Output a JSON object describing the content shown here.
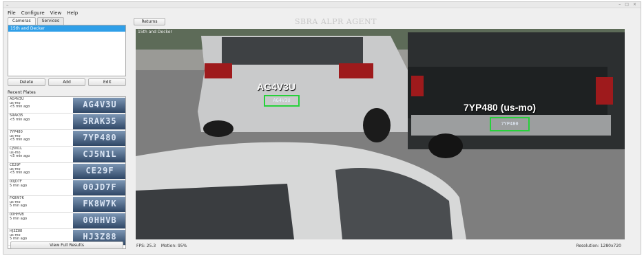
{
  "window": {
    "title": "SBRA ALPR AGENT",
    "controls": [
      "–",
      "□",
      "×"
    ]
  },
  "menu": [
    "File",
    "Configure",
    "View",
    "Help"
  ],
  "left_panel": {
    "tabs": [
      "Cameras",
      "Services"
    ],
    "cameras": [
      "15th and Decker"
    ],
    "buttons": {
      "delete": "Delete",
      "add": "Add",
      "edit": "Edit"
    },
    "recent_label": "Recent Plates",
    "plates": [
      {
        "plate": "AG4V3U",
        "region": "us-mo",
        "time": "<5 min ago",
        "image_text": "AG4V3U"
      },
      {
        "plate": "5RAK35",
        "region": "",
        "time": "<5 min ago",
        "image_text": "5RAK35"
      },
      {
        "plate": "7YP480",
        "region": "us-mo",
        "time": "<5 min ago",
        "image_text": "7YP480"
      },
      {
        "plate": "CJ5N1L",
        "region": "us-mo",
        "time": "<5 min ago",
        "image_text": "CJ5N1L"
      },
      {
        "plate": "CE29F",
        "region": "us-mo",
        "time": "<5 min ago",
        "image_text": "CE29F"
      },
      {
        "plate": "00JD7F",
        "region": "",
        "time": "5 min ago",
        "image_text": "00JD7F"
      },
      {
        "plate": "FK8W7K",
        "region": "us-mo",
        "time": "5 min ago",
        "image_text": "FK8W7K"
      },
      {
        "plate": "00HHVB",
        "region": "",
        "time": "5 min ago",
        "image_text": "00HHVB"
      },
      {
        "plate": "HJ3Z88",
        "region": "us-mo",
        "time": "5 min ago",
        "image_text": "HJ3Z88"
      }
    ],
    "view_full": "View Full Results"
  },
  "main": {
    "returns_button": "Returns",
    "camera_label": "15th and Decker",
    "detections": [
      {
        "label": "AG4V3U",
        "plate_text": "AG4V3U"
      },
      {
        "label": "7YP480 (us-mo)",
        "plate_text": "7YP480"
      }
    ]
  },
  "status": {
    "fps": "FPS: 25.3",
    "motion": "Motion: 95%",
    "resolution": "Resolution: 1280x720"
  },
  "colors": {
    "selection": "#2f9fe8",
    "detection_box": "#26d13a"
  }
}
